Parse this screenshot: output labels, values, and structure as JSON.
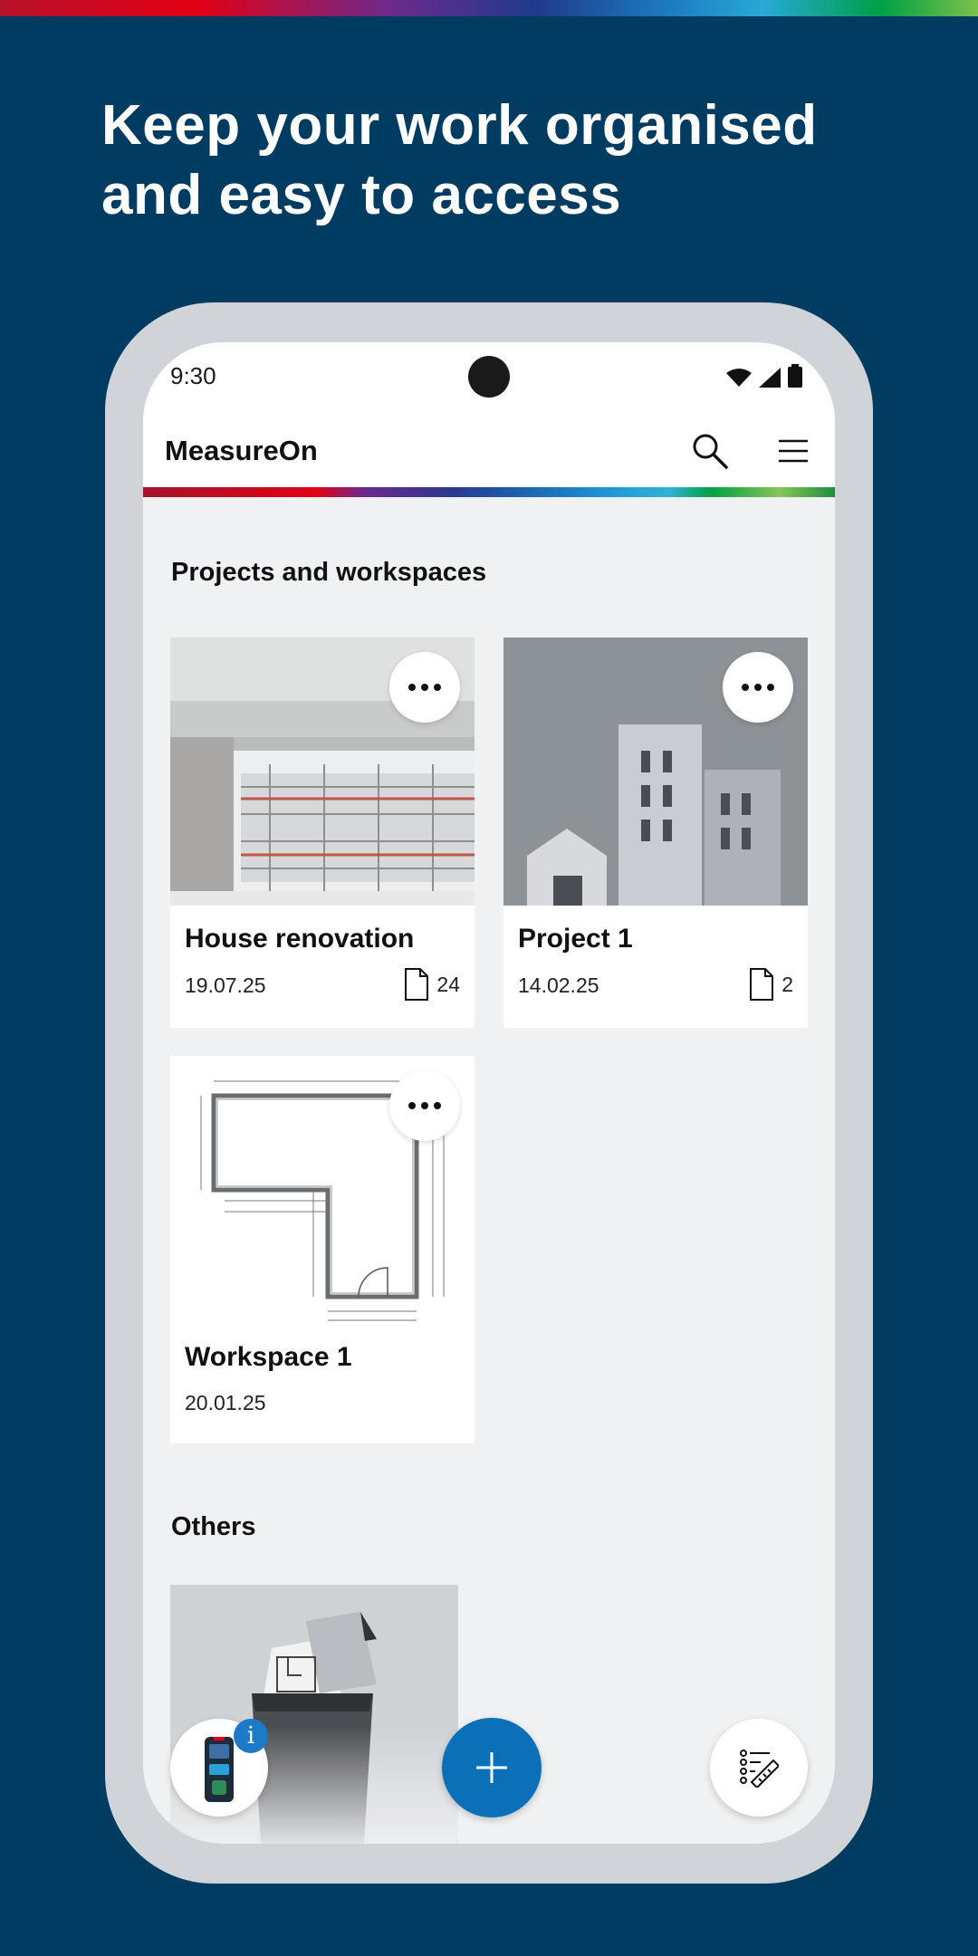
{
  "headline": "Keep your work organised and easy to access",
  "status_bar": {
    "time": "9:30"
  },
  "app_bar": {
    "title": "MeasureOn"
  },
  "sections": {
    "projects_title": "Projects and workspaces",
    "others_title": "Others"
  },
  "cards": [
    {
      "title": "House renovation",
      "date": "19.07.25",
      "count": "24"
    },
    {
      "title": "Project 1",
      "date": "14.02.25",
      "count": "2"
    },
    {
      "title": "Workspace 1",
      "date": "20.01.25"
    }
  ],
  "badges": {
    "info": "i"
  },
  "colors": {
    "background": "#003b62",
    "accent_blue": "#0b70b8",
    "card_bg": "#ffffff",
    "screen_bg": "#eff1f2"
  },
  "icons": [
    "search-icon",
    "menu-icon",
    "more-icon",
    "document-icon",
    "plus-icon",
    "measure-list-icon",
    "laser-device-icon",
    "wifi-icon",
    "signal-icon",
    "battery-icon"
  ]
}
